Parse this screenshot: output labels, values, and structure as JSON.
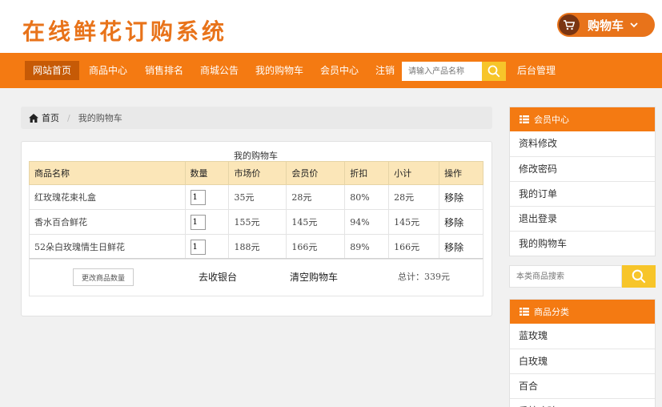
{
  "header": {
    "site_title": "在线鲜花订购系统",
    "cart_button_label": "购物车"
  },
  "nav": {
    "items": [
      "网站首页",
      "商品中心",
      "销售排名",
      "商城公告",
      "我的购物车",
      "会员中心",
      "注销"
    ],
    "active_index": 0,
    "search_placeholder": "请输入产品名称",
    "admin_label": "后台管理"
  },
  "breadcrumb": {
    "home": "首页",
    "current": "我的购物车"
  },
  "cart": {
    "caption": "我的购物车",
    "columns": [
      "商品名称",
      "数量",
      "市场价",
      "会员价",
      "折扣",
      "小计",
      "操作"
    ],
    "rows": [
      {
        "name": "红玫瑰花束礼盒",
        "qty": "1",
        "market": "35元",
        "member": "28元",
        "discount": "80%",
        "subtotal": "28元",
        "action": "移除"
      },
      {
        "name": "香水百合鲜花",
        "qty": "1",
        "market": "155元",
        "member": "145元",
        "discount": "94%",
        "subtotal": "145元",
        "action": "移除"
      },
      {
        "name": "52朵白玫瑰情生日鲜花",
        "qty": "1",
        "market": "188元",
        "member": "166元",
        "discount": "89%",
        "subtotal": "166元",
        "action": "移除"
      }
    ],
    "update_qty_label": "更改商品数量",
    "checkout_label": "去收银台",
    "clear_label": "清空购物车",
    "total_text": "总计：339元"
  },
  "sidebar": {
    "member_title": "会员中心",
    "member_items": [
      "资料修改",
      "修改密码",
      "我的订单",
      "退出登录",
      "我的购物车"
    ],
    "search_placeholder": "本类商品搜索",
    "category_title": "商品分类",
    "category_items": [
      "蓝玫瑰",
      "白玫瑰",
      "百合",
      "香槟玫瑰"
    ]
  },
  "colors": {
    "accent_orange": "#f47a12",
    "active_nav": "#c65a06",
    "search_yellow": "#f7c52a",
    "table_header": "#fbe6b8"
  },
  "icons": {
    "cart": "shopping-cart-icon",
    "search": "search-icon",
    "home": "home-icon",
    "list": "list-icon"
  }
}
